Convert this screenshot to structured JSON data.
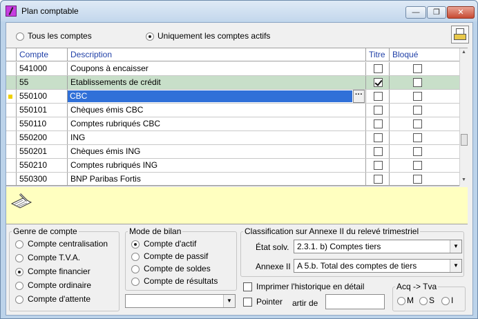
{
  "window": {
    "title": "Plan comptable",
    "minimize": "—",
    "maximize": "❐",
    "close": "✕"
  },
  "filter": {
    "all_label": "Tous les comptes",
    "active_label": "Uniquement les comptes actifs",
    "selected": "active"
  },
  "grid": {
    "headers": {
      "compte": "Compte",
      "description": "Description",
      "titre": "Titre",
      "bloque": "Bloqué"
    },
    "edit_ellipsis": "···",
    "rows": [
      {
        "compte": "541000",
        "description": "Coupons à encaisser",
        "titre": false,
        "bloque": false
      },
      {
        "compte": "55",
        "description": "Etablissements de crédit",
        "titre": true,
        "bloque": false
      },
      {
        "compte": "550100",
        "description": "CBC",
        "titre": false,
        "bloque": false
      },
      {
        "compte": "550101",
        "description": "Chèques émis CBC",
        "titre": false,
        "bloque": false
      },
      {
        "compte": "550110",
        "description": "Comptes rubriqués CBC",
        "titre": false,
        "bloque": false
      },
      {
        "compte": "550200",
        "description": "ING",
        "titre": false,
        "bloque": false
      },
      {
        "compte": "550201",
        "description": "Chèques émis ING",
        "titre": false,
        "bloque": false
      },
      {
        "compte": "550210",
        "description": "Comptes rubriqués ING",
        "titre": false,
        "bloque": false
      },
      {
        "compte": "550300",
        "description": "BNP Paribas Fortis",
        "titre": false,
        "bloque": false
      }
    ],
    "highlighted_row": 1,
    "current_row": 2
  },
  "genre": {
    "legend": "Genre de compte",
    "options": [
      "Compte centralisation",
      "Compte T.V.A.",
      "Compte financier",
      "Compte ordinaire",
      "Compte d'attente"
    ],
    "selected": 2
  },
  "bilan": {
    "legend": "Mode de bilan",
    "options": [
      "Compte d'actif",
      "Compte de passif",
      "Compte de soldes",
      "Compte de résultats"
    ],
    "selected": 0,
    "combo_value": ""
  },
  "classification": {
    "legend": "Classification sur Annexe II du relevé trimestriel",
    "etat_label": "État solv.",
    "etat_value": "2.3.1. b) Comptes tiers",
    "annexe_label": "Annexe II",
    "annexe_value": "A 5.b. Total des comptes de tiers"
  },
  "options": {
    "imprimer_label": "Imprimer l'historique en détail",
    "pointer_label": "Pointer",
    "artir_label": "artir de",
    "artir_value": ""
  },
  "acq": {
    "legend": "Acq -> Tva",
    "options": [
      "M",
      "S",
      "I"
    ]
  }
}
